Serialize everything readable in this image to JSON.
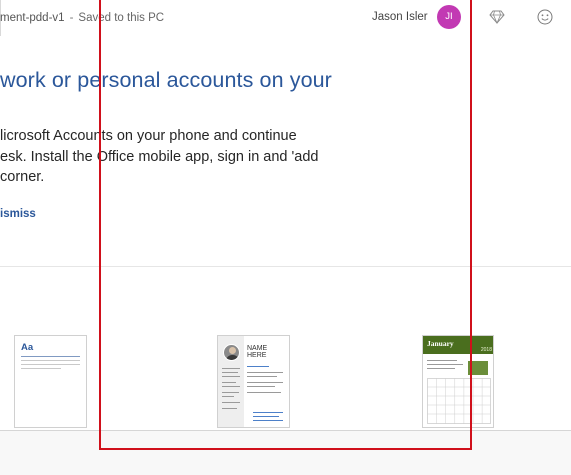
{
  "titlebar": {
    "document_name": "ment-pdd-v1",
    "separator": "-",
    "save_status": "Saved to this PC",
    "user_name": "Jason Isler",
    "user_initials": "JI",
    "avatar_color": "#c239b3",
    "icons": [
      "diamond-icon",
      "smiley-icon"
    ]
  },
  "banner": {
    "heading": "work or personal accounts on your",
    "body_lines": [
      "licrosoft Accounts on your phone and continue",
      "esk. Install the Office mobile app, sign in and 'add",
      "corner."
    ],
    "dismiss_label": "ismiss"
  },
  "templates": [
    {
      "kind": "blank",
      "preview_text": "Aa"
    },
    {
      "kind": "resume",
      "preview_text": "NAME HERE"
    },
    {
      "kind": "calendar",
      "preview_text": "January",
      "preview_year": "2018"
    }
  ],
  "colors": {
    "accent": "#2b579a",
    "highlight_frame": "#d0101b",
    "calendar_header": "#4a6e1e"
  }
}
